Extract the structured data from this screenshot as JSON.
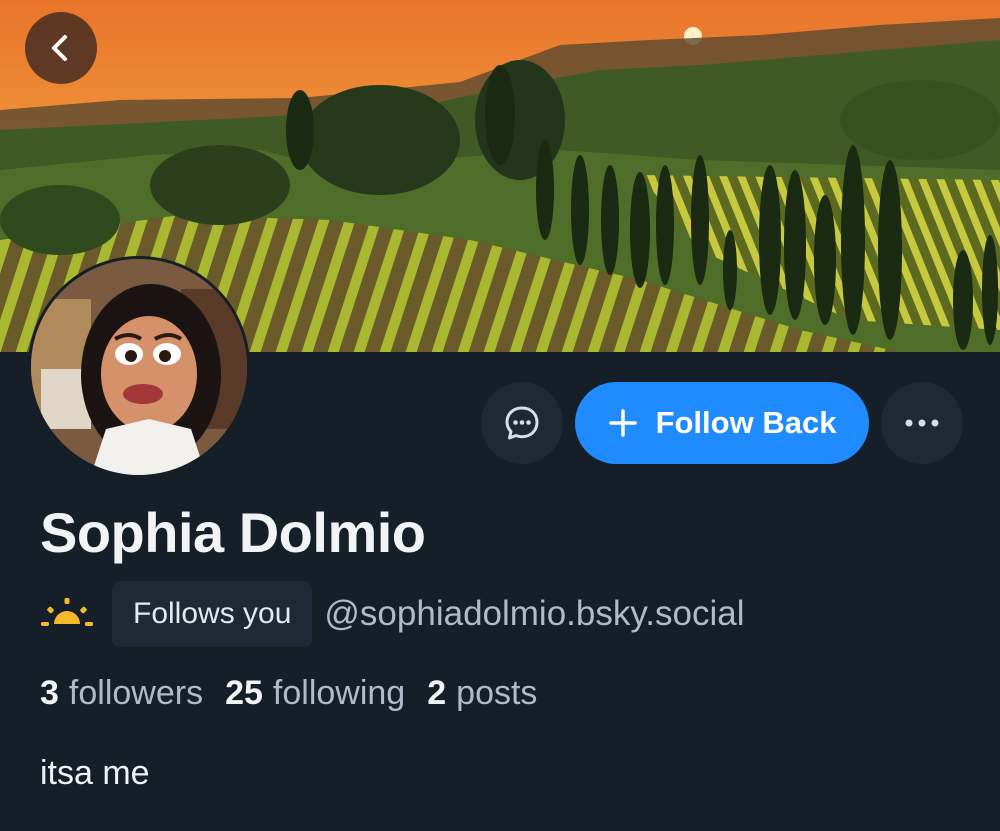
{
  "profile": {
    "display_name": "Sophia Dolmio",
    "follows_you_label": "Follows you",
    "handle": "@sophiadolmio.bsky.social",
    "bio": "itsa me"
  },
  "stats": {
    "followers_count": "3",
    "followers_label": "followers",
    "following_count": "25",
    "following_label": "following",
    "posts_count": "2",
    "posts_label": "posts"
  },
  "actions": {
    "follow_back_label": "Follow Back"
  },
  "colors": {
    "background": "#161e27",
    "accent": "#208bfe",
    "secondary_button": "#1f2935",
    "muted_text": "#aebbc9"
  },
  "icons": {
    "back": "chevron-left-icon",
    "message": "chat-bubble-icon",
    "follow": "plus-icon",
    "more": "ellipsis-icon",
    "status": "sun-icon"
  }
}
